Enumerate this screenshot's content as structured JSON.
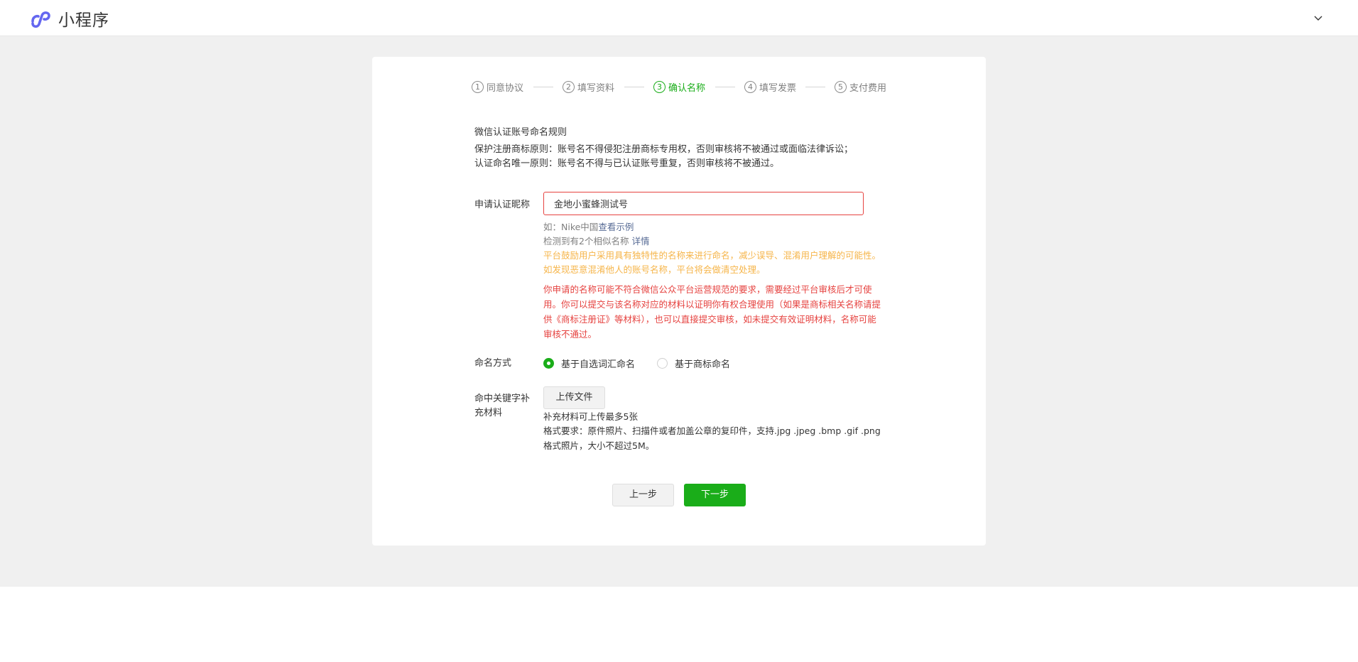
{
  "header": {
    "app_title": "小程序",
    "logo_icon": "miniprogram-logo-icon",
    "menu_icon": "chevron-down-icon",
    "brand_color": "#6467f0"
  },
  "steps": [
    {
      "num": "1",
      "label": "同意协议",
      "active": false
    },
    {
      "num": "2",
      "label": "填写资料",
      "active": false
    },
    {
      "num": "3",
      "label": "确认名称",
      "active": true
    },
    {
      "num": "4",
      "label": "填写发票",
      "active": false
    },
    {
      "num": "5",
      "label": "支付费用",
      "active": false
    }
  ],
  "rules": {
    "title": "微信认证账号命名规则",
    "line1": "保护注册商标原则：账号名不得侵犯注册商标专用权，否则审核将不被通过或面临法律诉讼；",
    "line2": "认证命名唯一原则：账号名不得与已认证账号重复，否则审核将不被通过。"
  },
  "form": {
    "name_label": "申请认证昵称",
    "name_value": "金地小蜜蜂测试号",
    "example_prefix": "如：Nike中国",
    "example_link": "查看示例",
    "similar_text": "检测到有2个相似名称",
    "similar_link": "详情",
    "orange_line1": "平台鼓励用户采用具有独特性的名称来进行命名，减少误导、混淆用户理解的可能性。",
    "orange_line2": "如发现恶意混淆他人的账号名称，平台将会做清空处理。",
    "red_line1": "你申请的名称可能不符合微信公众平台运营规范的要求，需要经过平台审核后才可使",
    "red_line2": "用。你可以提交与该名称对应的材料以证明你有权合理使用（如果是商标相关名称请提",
    "red_line3": "供《商标注册证》等材料），也可以直接提交审核，如未提交有效证明材料，名称可能",
    "red_line4": "审核不通过。",
    "naming_label": "命名方式",
    "naming_option1": "基于自选词汇命名",
    "naming_option2": "基于商标命名",
    "naming_selected": "基于自选词汇命名",
    "upload_label_line1": "命中关键字补",
    "upload_label_line2": "充材料",
    "upload_button": "上传文件",
    "upload_tip1": "补充材料可上传最多5张",
    "upload_tip2": "格式要求：原件照片、扫描件或者加盖公章的复印件，支持.jpg .jpeg .bmp .gif .png",
    "upload_tip3": "格式照片，大小不超过5M。"
  },
  "footer": {
    "prev_label": "上一步",
    "next_label": "下一步"
  },
  "colors": {
    "primary_green": "#1aad19",
    "warning_orange": "#f6b54a",
    "error_red": "#e64340",
    "link_blue": "#576b95"
  }
}
